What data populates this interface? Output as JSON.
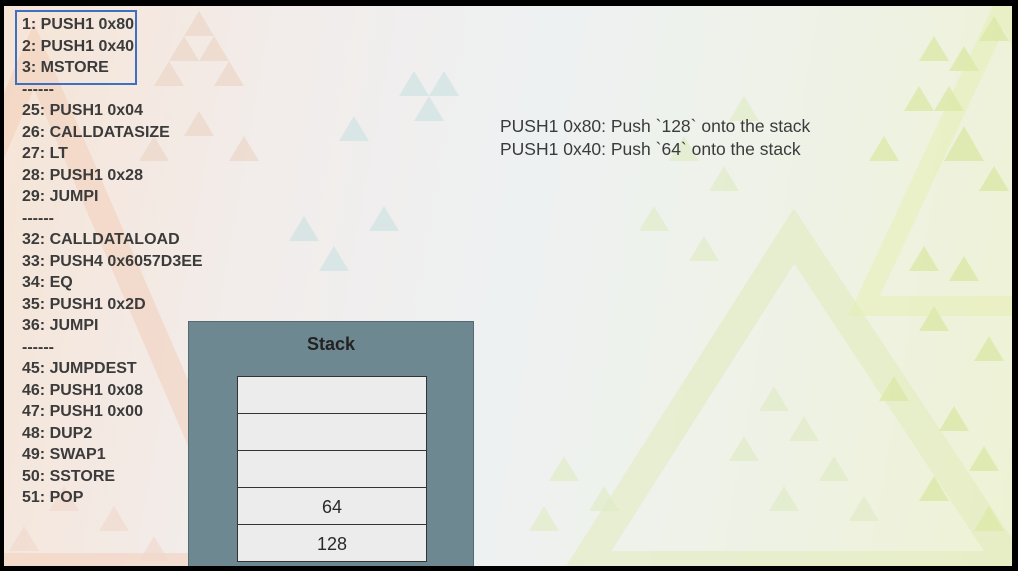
{
  "code": {
    "lines": [
      "1: PUSH1 0x80",
      "2: PUSH1 0x40",
      "3: MSTORE",
      "------",
      "25: PUSH1 0x04",
      "26: CALLDATASIZE",
      "27: LT",
      "28: PUSH1 0x28",
      "29: JUMPI",
      "------",
      "32: CALLDATALOAD",
      "33: PUSH4 0x6057D3EE",
      "34: EQ",
      "35: PUSH1 0x2D",
      "36: JUMPI",
      "------",
      "45: JUMPDEST",
      "46: PUSH1 0x08",
      "47: PUSH1 0x00",
      "48: DUP2",
      "49: SWAP1",
      "50: SSTORE",
      "51: POP"
    ]
  },
  "explanation": {
    "lines": [
      "PUSH1 0x80: Push `128` onto the stack",
      "PUSH1 0x40: Push `64` onto the stack"
    ]
  },
  "stack": {
    "title": "Stack",
    "cells": [
      "",
      "",
      "",
      "64",
      "128"
    ]
  },
  "colors": {
    "highlight_border": "#3d6fc2",
    "stack_panel": "#6e8891",
    "text": "#3b3b3b"
  }
}
